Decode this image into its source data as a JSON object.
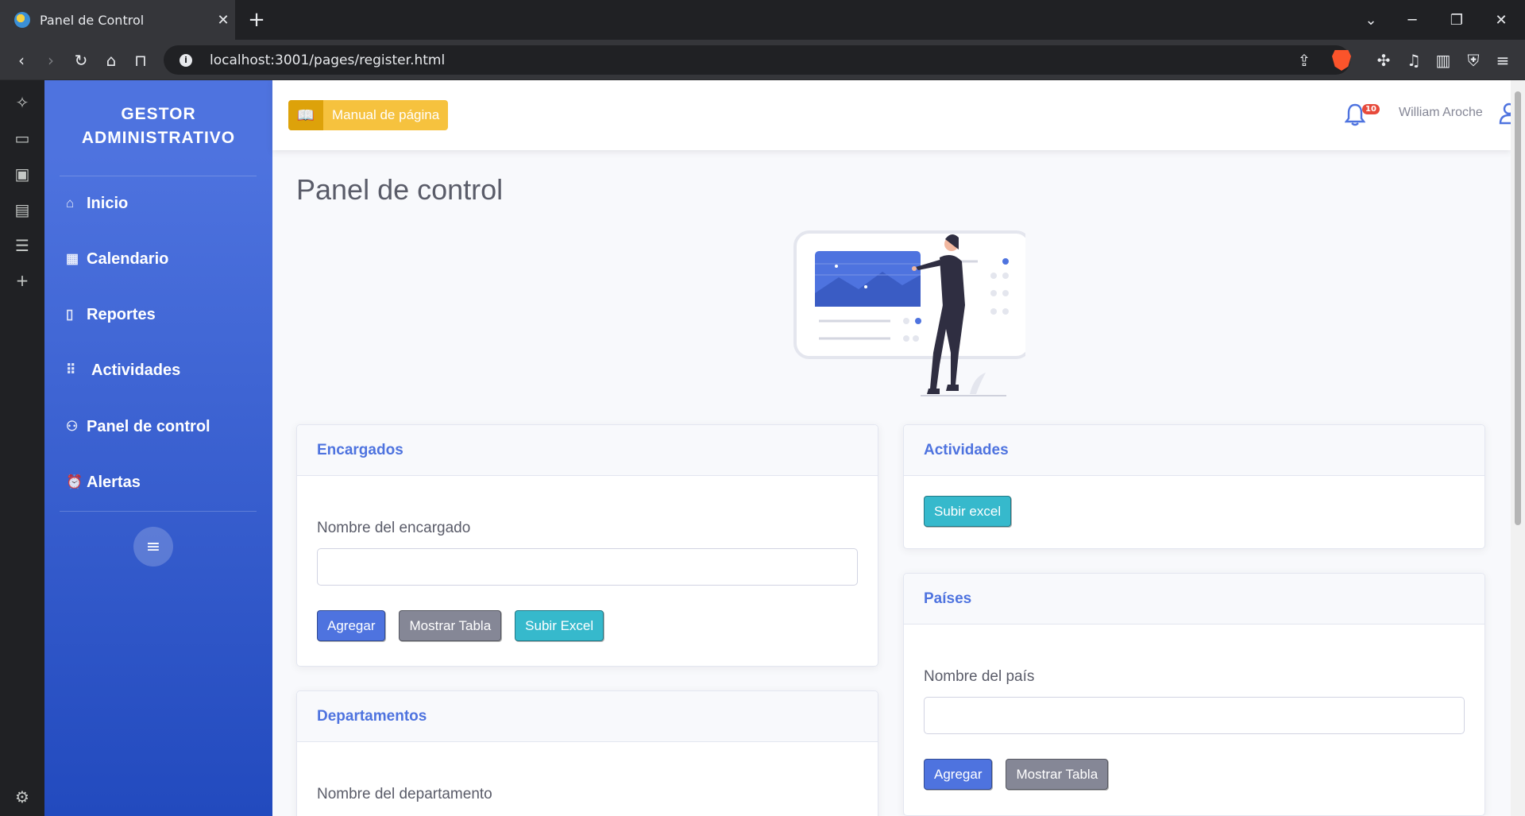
{
  "browser": {
    "tab_title": "Panel de Control",
    "url": "localhost:3001/pages/register.html"
  },
  "sidebar": {
    "brand_line1": "GESTOR",
    "brand_line2": "ADMINISTRATIVO",
    "items": [
      {
        "label": "Inicio",
        "icon": "home-icon"
      },
      {
        "label": "Calendario",
        "icon": "calendar-icon"
      },
      {
        "label": "Reportes",
        "icon": "document-icon"
      },
      {
        "label": "Actividades",
        "icon": "grid-icon"
      },
      {
        "label": "Panel de control",
        "icon": "user-settings-icon"
      },
      {
        "label": "Alertas",
        "icon": "alarm-icon"
      }
    ]
  },
  "topbar": {
    "manual_label": "Manual de página",
    "notification_count": "10",
    "username": "William Aroche"
  },
  "main": {
    "title": "Panel de control"
  },
  "cards": {
    "encargados": {
      "title": "Encargados",
      "field_label": "Nombre del encargado",
      "field_value": "",
      "add_label": "Agregar",
      "show_label": "Mostrar Tabla",
      "upload_label": "Subir Excel"
    },
    "actividades": {
      "title": "Actividades",
      "upload_label": "Subir excel"
    },
    "paises": {
      "title": "Países",
      "field_label": "Nombre del país",
      "field_value": "",
      "add_label": "Agregar",
      "show_label": "Mostrar Tabla"
    },
    "departamentos": {
      "title": "Departamentos",
      "field_label": "Nombre del departamento"
    }
  },
  "colors": {
    "primary": "#4e73df",
    "secondary": "#858796",
    "info": "#36b9cc",
    "warning": "#f6c23e",
    "danger": "#e74a3b"
  }
}
